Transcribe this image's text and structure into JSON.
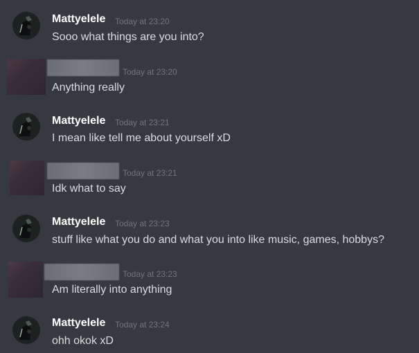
{
  "channel": {
    "background": "#36393f",
    "colors": {
      "username": "#ffffff",
      "timestamp": "#72767d",
      "message_text": "#dcddde"
    }
  },
  "messages": [
    {
      "author": "Mattyelele",
      "author_redacted": false,
      "timestamp": "Today at 23:20",
      "text": "Sooo what things are you into?"
    },
    {
      "author": "",
      "author_redacted": true,
      "timestamp": "Today at 23:20",
      "text": "Anything really"
    },
    {
      "author": "Mattyelele",
      "author_redacted": false,
      "timestamp": "Today at 23:21",
      "text": "I mean like tell me about yourself xD"
    },
    {
      "author": "",
      "author_redacted": true,
      "timestamp": "Today at 23:21",
      "text": "Idk what to say"
    },
    {
      "author": "Mattyelele",
      "author_redacted": false,
      "timestamp": "Today at 23:23",
      "text": "stuff like what you do and what you into like music, games, hobbys?"
    },
    {
      "author": "",
      "author_redacted": true,
      "timestamp": "Today at 23:23",
      "text": "Am literally into anything"
    },
    {
      "author": "Mattyelele",
      "author_redacted": false,
      "timestamp": "Today at 23:24",
      "text": "ohh okok xD"
    }
  ],
  "icons": {
    "mattyelele_avatar": "avatar-dark-figure-icon",
    "redacted_avatar": "blurred-avatar-icon"
  }
}
